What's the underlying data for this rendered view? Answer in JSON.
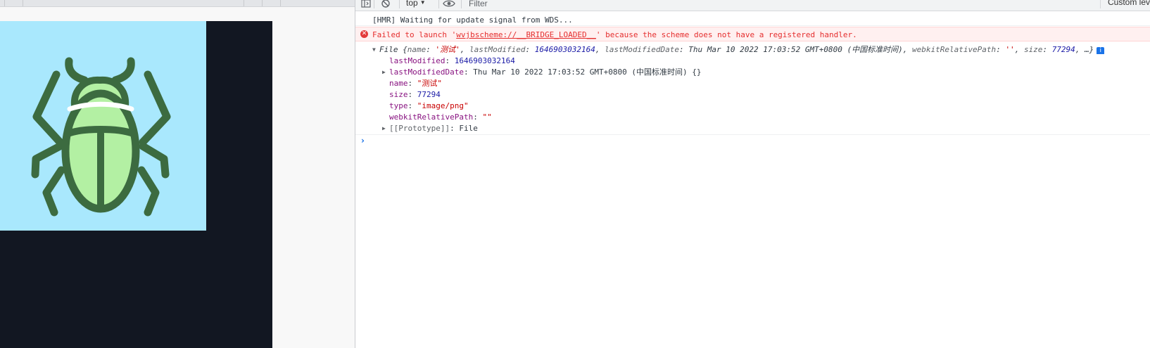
{
  "toolbar": {
    "context": "top",
    "filter_placeholder": "Filter",
    "log_levels_label": "Custom levels"
  },
  "console": {
    "hmr_message": "[HMR] Waiting for update signal from WDS...",
    "error": {
      "prefix": "Failed to launch '",
      "link": "wvjbscheme://__BRIDGE_LOADED__",
      "suffix": "' because the scheme does not have a registered handler."
    },
    "file_summary": {
      "label": "File ",
      "open": "{",
      "name_key": "name",
      "name_value": "'测试'",
      "lastmodified_key": "lastModified",
      "lastmodified_value": "1646903032164",
      "lastmodifieddate_key": "lastModifiedDate",
      "lastmodifieddate_value": "Thu Mar 10 2022 17:03:52 GMT+0800 (中国标准时间)",
      "webkit_key": "webkitRelativePath",
      "webkit_value": "''",
      "size_key": "size",
      "size_value": "77294",
      "ellipsis": "…}",
      "info_badge": "i"
    },
    "properties": {
      "lastModified": {
        "key": "lastModified",
        "value": "1646903032164"
      },
      "lastModifiedDate": {
        "key": "lastModifiedDate",
        "value": "Thu Mar 10 2022 17:03:52 GMT+0800 (中国标准时间) {}"
      },
      "name": {
        "key": "name",
        "value": "\"测试\""
      },
      "size": {
        "key": "size",
        "value": "77294"
      },
      "type": {
        "key": "type",
        "value": "\"image/png\""
      },
      "webkitRelativePath": {
        "key": "webkitRelativePath",
        "value": "\"\""
      },
      "prototype": {
        "key": "[[Prototype]]",
        "value": "File"
      }
    },
    "prompt_symbol": "›"
  },
  "colors": {
    "tile_background": "#a9e8fd",
    "bug_outline": "#3c6b40",
    "bug_fill": "#b3f0a3",
    "dark_background": "#121722",
    "error_text": "#e52e2e",
    "error_background": "#fff0f0"
  },
  "icons": {
    "preview_image": "bug-icon",
    "sidebar_toggle": "sidebar-toggle-icon",
    "clear": "clear-console-icon",
    "live_expression": "eye-icon"
  }
}
